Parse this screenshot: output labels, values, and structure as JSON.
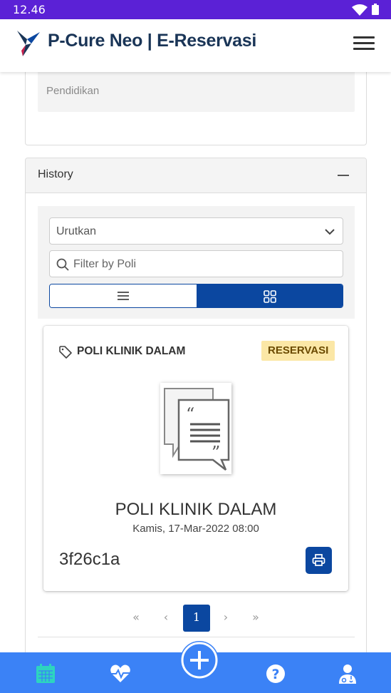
{
  "status_bar": {
    "time": "12.46"
  },
  "app_bar": {
    "title": "P-Cure Neo | E-Reservasi"
  },
  "previous_field": {
    "placeholder": "Pendidikan"
  },
  "history": {
    "title": "History",
    "sort_placeholder": "Urutkan",
    "filter_placeholder": "Filter by Poli",
    "view_mode": "grid"
  },
  "reservation_card": {
    "poli_label": "POLI KLINIK DALAM",
    "badge": "RESERVASI",
    "poli_title": "POLI KLINIK DALAM",
    "datetime": "Kamis, 17-Mar-2022 08:00",
    "code": "3f26c1a"
  },
  "pagination": {
    "first": "«",
    "prev": "‹",
    "current_page": "1",
    "next": "›",
    "last": "»"
  },
  "colors": {
    "status_bar": "#5b21d6",
    "primary": "#0b47a0",
    "bottom_nav": "#3b82f6",
    "badge_bg": "#fbe7a6",
    "active_nav_icon": "#2dd4bf"
  },
  "bottom_nav": [
    {
      "icon": "calendar-icon",
      "active": true
    },
    {
      "icon": "heartbeat-icon",
      "active": false
    },
    {
      "icon": "add-circle-icon",
      "active": false
    },
    {
      "icon": "help-icon",
      "active": false
    },
    {
      "icon": "doctor-icon",
      "active": false
    }
  ]
}
